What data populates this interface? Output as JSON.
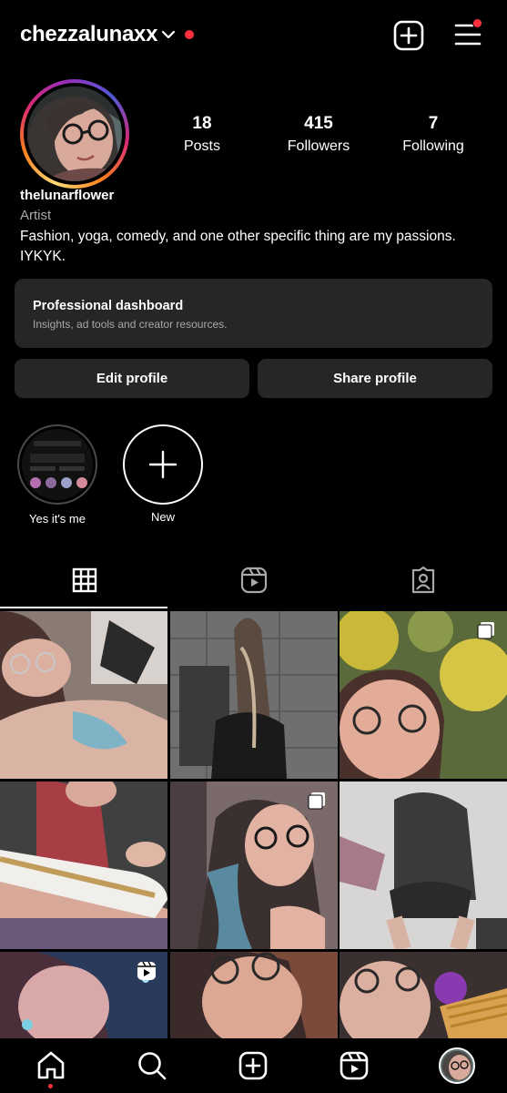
{
  "header": {
    "username": "chezzalunaxx"
  },
  "profile": {
    "stats": [
      {
        "value": "18",
        "label": "Posts"
      },
      {
        "value": "415",
        "label": "Followers"
      },
      {
        "value": "7",
        "label": "Following"
      }
    ],
    "display_name": "thelunarflower",
    "category": "Artist",
    "bio": "Fashion, yoga, comedy, and one other specific thing are my passions. IYKYK."
  },
  "dashboard": {
    "title": "Professional dashboard",
    "subtitle": "Insights, ad tools and creator resources."
  },
  "buttons": {
    "edit": "Edit profile",
    "share": "Share profile"
  },
  "highlights": [
    {
      "label": "Yes it's me"
    },
    {
      "label": "New"
    }
  ],
  "tabs": [
    {
      "icon": "grid-icon",
      "active": true
    },
    {
      "icon": "reels-icon",
      "active": false
    },
    {
      "icon": "tagged-icon",
      "active": false
    }
  ],
  "grid": [
    {
      "overlay": null
    },
    {
      "overlay": null
    },
    {
      "overlay": "carousel-icon"
    },
    {
      "overlay": null
    },
    {
      "overlay": "carousel-icon"
    },
    {
      "overlay": null
    },
    {
      "overlay": "reel-icon"
    },
    {
      "overlay": null
    },
    {
      "overlay": null
    }
  ],
  "bottom_nav": [
    {
      "icon": "home-icon",
      "active": true
    },
    {
      "icon": "search-icon",
      "active": false
    },
    {
      "icon": "create-icon",
      "active": false
    },
    {
      "icon": "reels-icon",
      "active": false
    },
    {
      "icon": "profile-avatar-icon",
      "active": false
    }
  ],
  "colors": {
    "background": "#000000",
    "surface": "#262626",
    "secondary_text": "#a8a8a8",
    "notification": "#ff3040"
  }
}
